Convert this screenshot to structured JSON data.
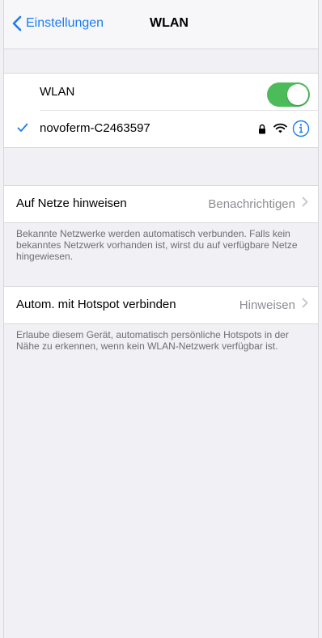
{
  "nav": {
    "back_label": "Einstellungen",
    "title": "WLAN"
  },
  "wlan": {
    "label": "WLAN",
    "enabled": true,
    "network": {
      "name": "novoferm-C2463597",
      "connected": true,
      "secured": true
    }
  },
  "ask_to_join": {
    "label": "Auf Netze hinweisen",
    "value": "Benachrichtigen",
    "footnote": "Bekannte Netzwerke werden automatisch verbunden. Falls kein bekanntes Netzwerk vorhanden ist, wirst du auf verfügbare Netze hingewiesen."
  },
  "hotspot": {
    "label": "Autom. mit Hotspot verbinden",
    "value": "Hinweisen",
    "footnote": "Erlaube diesem Gerät, automatisch persönliche Hotspots in der Nähe zu erkennen, wenn kein WLAN-Netzwerk verfügbar ist."
  },
  "colors": {
    "accent": "#1a7cf3",
    "toggle_on": "#4cbc5a",
    "background": "#f1f1f5",
    "secondary_text": "#8e8e93"
  },
  "icons": [
    "chevron-left-icon",
    "checkmark-icon",
    "lock-icon",
    "wifi-icon",
    "info-icon",
    "chevron-right-icon"
  ]
}
